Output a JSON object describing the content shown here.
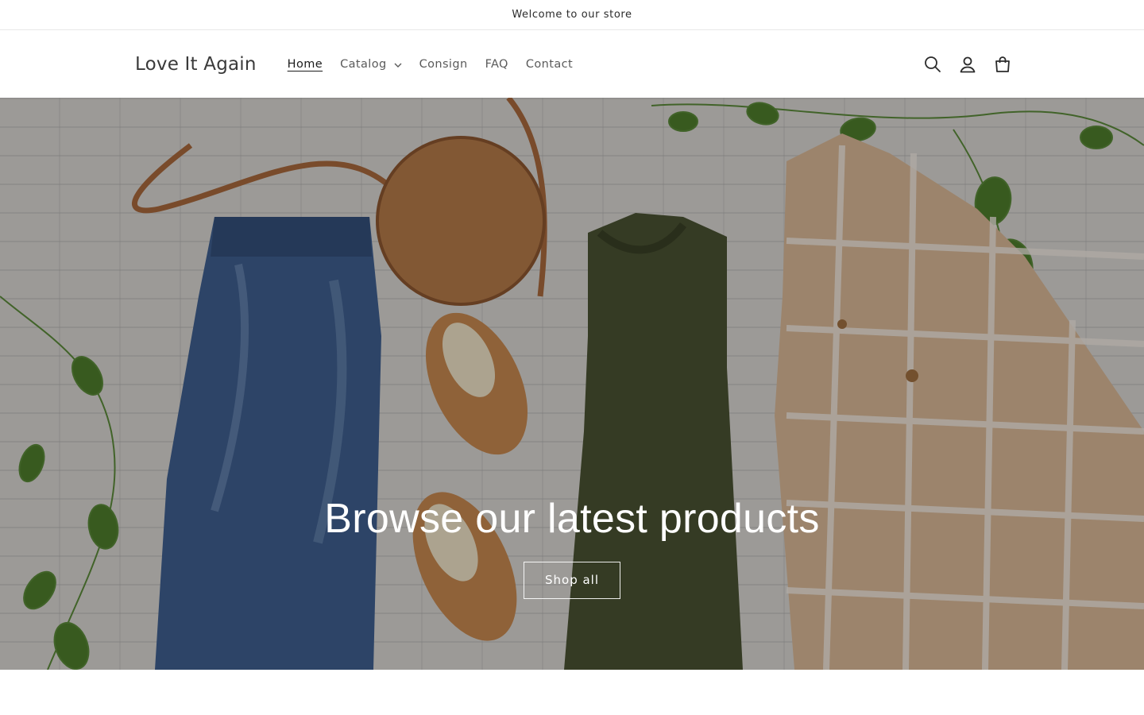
{
  "announcement": {
    "text": "Welcome to our store"
  },
  "header": {
    "logo": "Love It Again",
    "nav": [
      {
        "label": "Home",
        "active": true
      },
      {
        "label": "Catalog",
        "has_dropdown": true
      },
      {
        "label": "Consign"
      },
      {
        "label": "FAQ"
      },
      {
        "label": "Contact"
      }
    ],
    "icons": [
      "search-icon",
      "account-icon",
      "cart-icon"
    ]
  },
  "hero": {
    "title": "Browse our latest products",
    "button_label": "Shop all"
  },
  "colors": {
    "text_dark": "#121212",
    "nav_text": "#5a5a5a",
    "hero_overlay": "rgba(0,0,0,0.28)",
    "denim": "#3f5f8f",
    "leather": "#b57a48",
    "sweater": "#4a5232",
    "plaid": "#d9b896",
    "leaf": "#4e7d2c"
  }
}
